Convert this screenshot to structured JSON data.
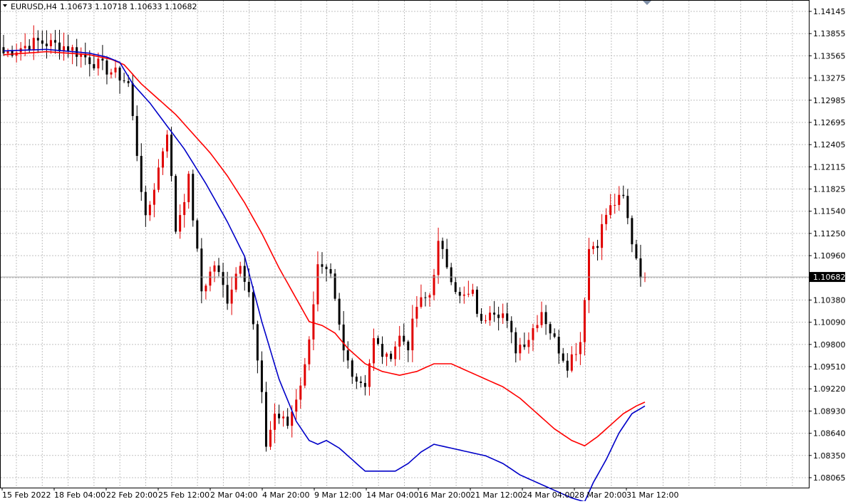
{
  "header": {
    "symbol": "EURUSD,H4",
    "ohlc": "1.10673 1.10718 1.10633 1.10682",
    "menu_icon": "triangle-down-icon"
  },
  "colors": {
    "up_candle": "#e00000",
    "down_candle": "#000000",
    "ma_fast": "#0000c8",
    "ma_slow": "#ff0000",
    "grid": "#c0c0c0",
    "price_label_bg": "#000000",
    "price_label_text": "#ffffff"
  },
  "chart_data": {
    "type": "candlestick",
    "symbol": "EURUSD",
    "timeframe": "H4",
    "y_ticks": [
      "1.14145",
      "1.13855",
      "1.13565",
      "1.13275",
      "1.12985",
      "1.12695",
      "1.12405",
      "1.12115",
      "1.11825",
      "1.11540",
      "1.11250",
      "1.10960",
      "1.10670",
      "1.10380",
      "1.10090",
      "1.09800",
      "1.09510",
      "1.09220",
      "1.08930",
      "1.08640",
      "1.08350",
      "1.08065"
    ],
    "x_ticks": [
      "15 Feb 2022",
      "18 Feb 04:00",
      "22 Feb 20:00",
      "25 Feb 12:00",
      "2 Mar 04:00",
      "4 Mar 20:00",
      "9 Mar 12:00",
      "14 Mar 04:00",
      "16 Mar 20:00",
      "21 Mar 12:00",
      "24 Mar 04:00",
      "28 Mar 20:00",
      "31 Mar 12:00"
    ],
    "ylim": [
      1.0795,
      1.1425
    ],
    "current_price": "1.10682",
    "grid": true,
    "candle_count": 150,
    "close_anchors": [
      [
        0,
        1.136
      ],
      [
        8,
        1.1375
      ],
      [
        15,
        1.1368
      ],
      [
        22,
        1.1345
      ],
      [
        27,
        1.133
      ],
      [
        29,
        1.132
      ],
      [
        31,
        1.123
      ],
      [
        33,
        1.114
      ],
      [
        36,
        1.121
      ],
      [
        38,
        1.126
      ],
      [
        40,
        1.113
      ],
      [
        43,
        1.1195
      ],
      [
        46,
        1.105
      ],
      [
        49,
        1.1085
      ],
      [
        52,
        1.104
      ],
      [
        55,
        1.109
      ],
      [
        57,
        1.105
      ],
      [
        60,
        1.091
      ],
      [
        61,
        1.085
      ],
      [
        63,
        1.089
      ],
      [
        66,
        1.0875
      ],
      [
        70,
        1.095
      ],
      [
        73,
        1.108
      ],
      [
        76,
        1.1065
      ],
      [
        79,
        1.097
      ],
      [
        82,
        1.0935
      ],
      [
        84,
        1.093
      ],
      [
        86,
        1.0985
      ],
      [
        89,
        1.096
      ],
      [
        92,
        1.099
      ],
      [
        94,
        1.098
      ],
      [
        96,
        1.103
      ],
      [
        99,
        1.1045
      ],
      [
        101,
        1.111
      ],
      [
        103,
        1.1085
      ],
      [
        106,
        1.104
      ],
      [
        109,
        1.1045
      ],
      [
        111,
        1.1005
      ],
      [
        113,
        1.103
      ],
      [
        116,
        1.102
      ],
      [
        119,
        1.0975
      ],
      [
        122,
        1.099
      ],
      [
        125,
        1.1025
      ],
      [
        128,
        1.0985
      ],
      [
        131,
        1.0955
      ],
      [
        134,
        1.0985
      ],
      [
        136,
        1.1105
      ],
      [
        138,
        1.1115
      ],
      [
        140,
        1.115
      ],
      [
        142,
        1.1165
      ],
      [
        144,
        1.117
      ],
      [
        146,
        1.1115
      ],
      [
        148,
        1.1075
      ],
      [
        149,
        1.10682
      ]
    ],
    "ma_fast_anchors": [
      [
        0,
        1.1363
      ],
      [
        10,
        1.1365
      ],
      [
        20,
        1.136
      ],
      [
        24,
        1.1355
      ],
      [
        27,
        1.1348
      ],
      [
        30,
        1.132
      ],
      [
        34,
        1.1295
      ],
      [
        38,
        1.1265
      ],
      [
        42,
        1.1235
      ],
      [
        47,
        1.119
      ],
      [
        52,
        1.114
      ],
      [
        56,
        1.1095
      ],
      [
        60,
        1.101
      ],
      [
        64,
        1.0935
      ],
      [
        68,
        1.088
      ],
      [
        71,
        1.0855
      ],
      [
        73,
        1.085
      ],
      [
        75,
        1.0855
      ],
      [
        78,
        1.0845
      ],
      [
        81,
        1.083
      ],
      [
        84,
        1.0815
      ],
      [
        88,
        1.0815
      ],
      [
        91,
        1.0815
      ],
      [
        94,
        1.0825
      ],
      [
        97,
        1.084
      ],
      [
        100,
        1.085
      ],
      [
        104,
        1.0845
      ],
      [
        108,
        1.084
      ],
      [
        112,
        1.0835
      ],
      [
        116,
        1.0825
      ],
      [
        120,
        1.081
      ],
      [
        124,
        1.08
      ],
      [
        128,
        1.079
      ],
      [
        132,
        1.078
      ],
      [
        135,
        1.0775
      ],
      [
        137,
        1.08
      ],
      [
        140,
        1.083
      ],
      [
        143,
        1.0865
      ],
      [
        146,
        1.089
      ],
      [
        149,
        1.09
      ]
    ],
    "ma_slow_anchors": [
      [
        0,
        1.1358
      ],
      [
        10,
        1.1362
      ],
      [
        20,
        1.1358
      ],
      [
        25,
        1.1352
      ],
      [
        28,
        1.1345
      ],
      [
        32,
        1.132
      ],
      [
        36,
        1.13
      ],
      [
        40,
        1.128
      ],
      [
        44,
        1.1255
      ],
      [
        48,
        1.123
      ],
      [
        52,
        1.12
      ],
      [
        56,
        1.1165
      ],
      [
        60,
        1.1125
      ],
      [
        64,
        1.108
      ],
      [
        68,
        1.104
      ],
      [
        71,
        1.101
      ],
      [
        74,
        1.1005
      ],
      [
        77,
        1.0995
      ],
      [
        80,
        1.0975
      ],
      [
        84,
        1.0955
      ],
      [
        88,
        1.0945
      ],
      [
        92,
        1.094
      ],
      [
        96,
        1.0945
      ],
      [
        100,
        1.0955
      ],
      [
        104,
        1.0955
      ],
      [
        108,
        1.0945
      ],
      [
        112,
        1.0935
      ],
      [
        116,
        1.0925
      ],
      [
        120,
        1.091
      ],
      [
        124,
        1.089
      ],
      [
        128,
        1.087
      ],
      [
        132,
        1.0855
      ],
      [
        135,
        1.0848
      ],
      [
        138,
        1.086
      ],
      [
        141,
        1.0875
      ],
      [
        144,
        1.089
      ],
      [
        147,
        1.09
      ],
      [
        149,
        1.0905
      ]
    ]
  }
}
